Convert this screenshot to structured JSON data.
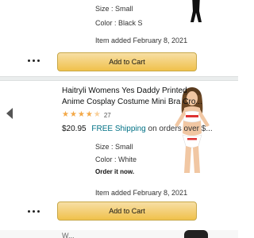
{
  "top_item": {
    "size_label": "Size : Small",
    "color_label": "Color : Black S",
    "date_added": "Item added February 8, 2021",
    "add_to_cart": "Add to Cart"
  },
  "item": {
    "title_line1": "Haitryli Womens Yes Daddy Printed",
    "title_line2": "Anime Cosplay Costume Mini Bra Cro...",
    "rating_count": "27",
    "price": "$20.95",
    "free_shipping": "FREE Shipping",
    "shipping_rest": "on orders over $...",
    "size_label": "Size : Small",
    "color_label": "Color : White",
    "order_note": "Order it now.",
    "date_added": "Item added February 8, 2021",
    "add_to_cart": "Add to Cart"
  },
  "bottom_item": {
    "title_partial": "W..."
  },
  "colors": {
    "accent_button": "#f0c14b",
    "link": "#007185",
    "star": "#f3a847"
  }
}
